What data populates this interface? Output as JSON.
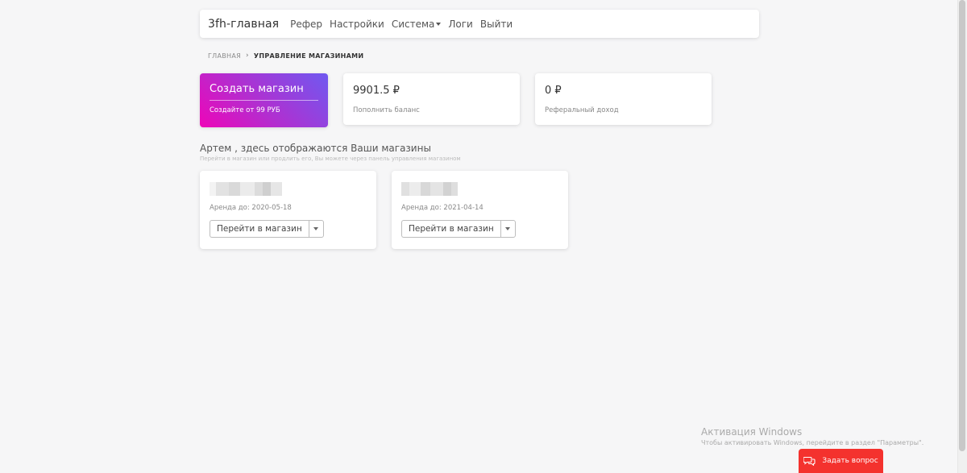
{
  "navbar": {
    "brand": "3fh-главная",
    "links": [
      "Рефер",
      "Настройки",
      "Система",
      "Логи",
      "Выйти"
    ]
  },
  "breadcrumb": {
    "home": "ГЛАВНАЯ",
    "current": "УПРАВЛЕНИЕ МАГАЗИНАМИ"
  },
  "create_card": {
    "title": "Создать магазин",
    "subtitle": "Создайте от 99 РУБ",
    "gradient_start": "#ee05b8",
    "gradient_end": "#6f59f0"
  },
  "balance_card": {
    "value": "9901.5 ₽",
    "label": "Пополнить баланс"
  },
  "ref_card": {
    "value": "0 ₽",
    "label": "Реферальный доход"
  },
  "section": {
    "title": "Артем , здесь отображаются Ваши магазины",
    "subtitle": "Перейти в магазин или продлить его, Вы можете через панель управления магазином"
  },
  "shops": [
    {
      "rent": "Аренда до: 2020-05-18",
      "button_label": "Перейти в магазин"
    },
    {
      "rent": "Аренда до: 2021-04-14",
      "button_label": "Перейти в магазин"
    }
  ],
  "windows_activation": {
    "title": "Активация Windows",
    "text": "Чтобы активировать Windows, перейдите в раздел \"Параметры\"."
  },
  "ask_button": {
    "label": "Задать вопрос",
    "color": "#f4322e"
  }
}
